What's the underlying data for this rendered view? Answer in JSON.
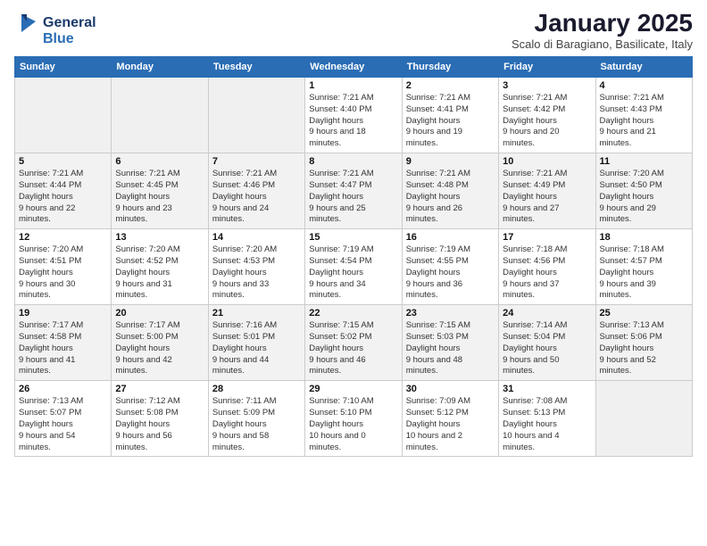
{
  "header": {
    "logo_line1": "General",
    "logo_line2": "Blue",
    "month_title": "January 2025",
    "subtitle": "Scalo di Baragiano, Basilicate, Italy"
  },
  "weekdays": [
    "Sunday",
    "Monday",
    "Tuesday",
    "Wednesday",
    "Thursday",
    "Friday",
    "Saturday"
  ],
  "weeks": [
    [
      {
        "day": "",
        "empty": true
      },
      {
        "day": "",
        "empty": true
      },
      {
        "day": "",
        "empty": true
      },
      {
        "day": "1",
        "sunrise": "7:21 AM",
        "sunset": "4:40 PM",
        "daylight": "9 hours and 18 minutes."
      },
      {
        "day": "2",
        "sunrise": "7:21 AM",
        "sunset": "4:41 PM",
        "daylight": "9 hours and 19 minutes."
      },
      {
        "day": "3",
        "sunrise": "7:21 AM",
        "sunset": "4:42 PM",
        "daylight": "9 hours and 20 minutes."
      },
      {
        "day": "4",
        "sunrise": "7:21 AM",
        "sunset": "4:43 PM",
        "daylight": "9 hours and 21 minutes."
      }
    ],
    [
      {
        "day": "5",
        "sunrise": "7:21 AM",
        "sunset": "4:44 PM",
        "daylight": "9 hours and 22 minutes."
      },
      {
        "day": "6",
        "sunrise": "7:21 AM",
        "sunset": "4:45 PM",
        "daylight": "9 hours and 23 minutes."
      },
      {
        "day": "7",
        "sunrise": "7:21 AM",
        "sunset": "4:46 PM",
        "daylight": "9 hours and 24 minutes."
      },
      {
        "day": "8",
        "sunrise": "7:21 AM",
        "sunset": "4:47 PM",
        "daylight": "9 hours and 25 minutes."
      },
      {
        "day": "9",
        "sunrise": "7:21 AM",
        "sunset": "4:48 PM",
        "daylight": "9 hours and 26 minutes."
      },
      {
        "day": "10",
        "sunrise": "7:21 AM",
        "sunset": "4:49 PM",
        "daylight": "9 hours and 27 minutes."
      },
      {
        "day": "11",
        "sunrise": "7:20 AM",
        "sunset": "4:50 PM",
        "daylight": "9 hours and 29 minutes."
      }
    ],
    [
      {
        "day": "12",
        "sunrise": "7:20 AM",
        "sunset": "4:51 PM",
        "daylight": "9 hours and 30 minutes."
      },
      {
        "day": "13",
        "sunrise": "7:20 AM",
        "sunset": "4:52 PM",
        "daylight": "9 hours and 31 minutes."
      },
      {
        "day": "14",
        "sunrise": "7:20 AM",
        "sunset": "4:53 PM",
        "daylight": "9 hours and 33 minutes."
      },
      {
        "day": "15",
        "sunrise": "7:19 AM",
        "sunset": "4:54 PM",
        "daylight": "9 hours and 34 minutes."
      },
      {
        "day": "16",
        "sunrise": "7:19 AM",
        "sunset": "4:55 PM",
        "daylight": "9 hours and 36 minutes."
      },
      {
        "day": "17",
        "sunrise": "7:18 AM",
        "sunset": "4:56 PM",
        "daylight": "9 hours and 37 minutes."
      },
      {
        "day": "18",
        "sunrise": "7:18 AM",
        "sunset": "4:57 PM",
        "daylight": "9 hours and 39 minutes."
      }
    ],
    [
      {
        "day": "19",
        "sunrise": "7:17 AM",
        "sunset": "4:58 PM",
        "daylight": "9 hours and 41 minutes."
      },
      {
        "day": "20",
        "sunrise": "7:17 AM",
        "sunset": "5:00 PM",
        "daylight": "9 hours and 42 minutes."
      },
      {
        "day": "21",
        "sunrise": "7:16 AM",
        "sunset": "5:01 PM",
        "daylight": "9 hours and 44 minutes."
      },
      {
        "day": "22",
        "sunrise": "7:15 AM",
        "sunset": "5:02 PM",
        "daylight": "9 hours and 46 minutes."
      },
      {
        "day": "23",
        "sunrise": "7:15 AM",
        "sunset": "5:03 PM",
        "daylight": "9 hours and 48 minutes."
      },
      {
        "day": "24",
        "sunrise": "7:14 AM",
        "sunset": "5:04 PM",
        "daylight": "9 hours and 50 minutes."
      },
      {
        "day": "25",
        "sunrise": "7:13 AM",
        "sunset": "5:06 PM",
        "daylight": "9 hours and 52 minutes."
      }
    ],
    [
      {
        "day": "26",
        "sunrise": "7:13 AM",
        "sunset": "5:07 PM",
        "daylight": "9 hours and 54 minutes."
      },
      {
        "day": "27",
        "sunrise": "7:12 AM",
        "sunset": "5:08 PM",
        "daylight": "9 hours and 56 minutes."
      },
      {
        "day": "28",
        "sunrise": "7:11 AM",
        "sunset": "5:09 PM",
        "daylight": "9 hours and 58 minutes."
      },
      {
        "day": "29",
        "sunrise": "7:10 AM",
        "sunset": "5:10 PM",
        "daylight": "10 hours and 0 minutes."
      },
      {
        "day": "30",
        "sunrise": "7:09 AM",
        "sunset": "5:12 PM",
        "daylight": "10 hours and 2 minutes."
      },
      {
        "day": "31",
        "sunrise": "7:08 AM",
        "sunset": "5:13 PM",
        "daylight": "10 hours and 4 minutes."
      },
      {
        "day": "",
        "empty": true
      }
    ]
  ],
  "labels": {
    "sunrise": "Sunrise:",
    "sunset": "Sunset:",
    "daylight": "Daylight hours"
  }
}
